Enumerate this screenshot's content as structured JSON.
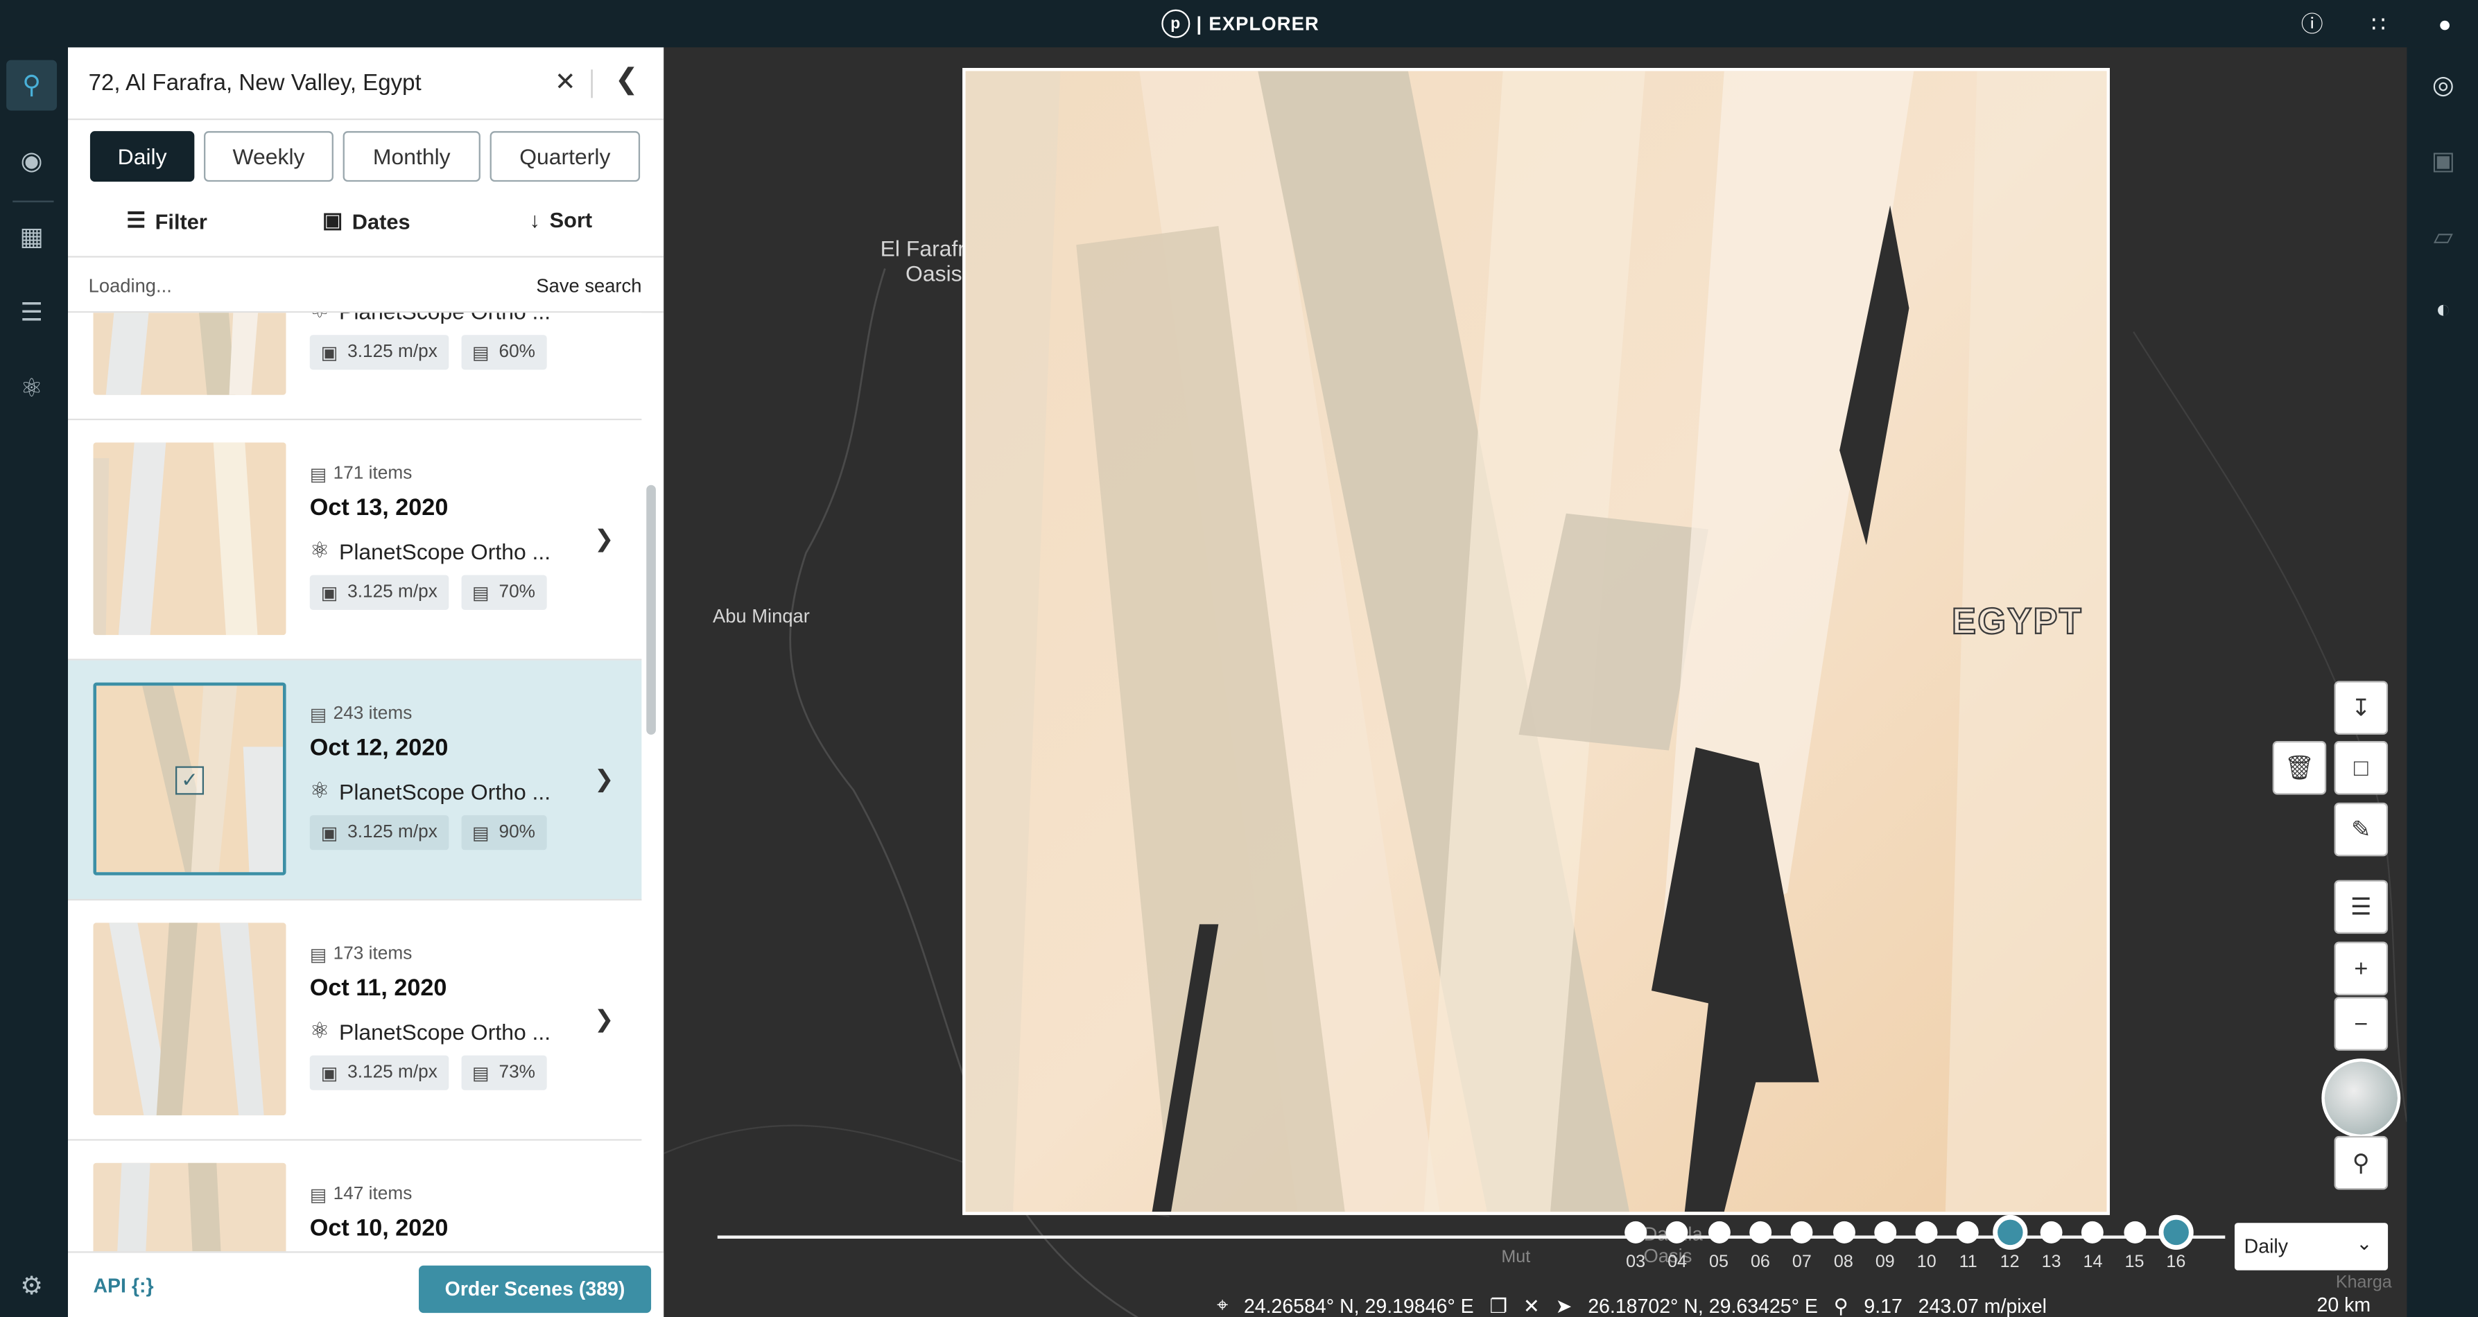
{
  "app": {
    "title": "EXPLORER",
    "logo_letter": "p"
  },
  "search": {
    "value": "72, Al Farafra, New Valley, Egypt"
  },
  "periods": [
    "Daily",
    "Weekly",
    "Monthly",
    "Quarterly"
  ],
  "tools": {
    "filter": "Filter",
    "dates": "Dates",
    "sort": "Sort"
  },
  "status_row": {
    "loading": "Loading...",
    "save_search": "Save search"
  },
  "results": [
    {
      "count": "",
      "date": "",
      "product": "PlanetScope Ortho ...",
      "resolution": "3.125 m/px",
      "coverage": "60%"
    },
    {
      "count": "171 items",
      "date": "Oct 13, 2020",
      "product": "PlanetScope Ortho ...",
      "resolution": "3.125 m/px",
      "coverage": "70%"
    },
    {
      "count": "243 items",
      "date": "Oct 12, 2020",
      "product": "PlanetScope Ortho ...",
      "resolution": "3.125 m/px",
      "coverage": "90%"
    },
    {
      "count": "173 items",
      "date": "Oct 11, 2020",
      "product": "PlanetScope Ortho ...",
      "resolution": "3.125 m/px",
      "coverage": "73%"
    },
    {
      "count": "147 items",
      "date": "Oct 10, 2020",
      "product": "",
      "resolution": "",
      "coverage": ""
    }
  ],
  "footer": {
    "api": "API {:}",
    "order": "Order Scenes (389)"
  },
  "map": {
    "labels": {
      "farafra_1": "El Farafra",
      "farafra_2": "Oasis",
      "abu_minqar": "Abu Minqar",
      "egypt": "EGYPT",
      "dakhla_1": "Dakhla",
      "dakhla_2": "Oasis",
      "mut": "Mut",
      "kharga": "Kharga"
    }
  },
  "timeline": {
    "days": [
      "03",
      "04",
      "05",
      "06",
      "07",
      "08",
      "09",
      "10",
      "11",
      "12",
      "13",
      "14",
      "15",
      "16"
    ],
    "selected": [
      "12",
      "16"
    ],
    "interval": "Daily"
  },
  "statusbar": {
    "cursor": "24.26584° N, 29.19846° E",
    "center": "26.18702° N, 29.63425° E",
    "zoom": "9.17",
    "resolution": "243.07 m/pixel",
    "scale": "20 km"
  },
  "colors": {
    "accent": "#3c8fa5",
    "nav": "#13232b",
    "selected_card": "#d9ebef"
  }
}
